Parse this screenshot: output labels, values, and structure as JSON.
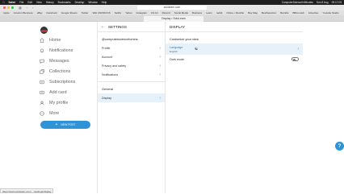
{
  "menubar": {
    "items": [
      "Safari",
      "File",
      "Edit",
      "View",
      "History",
      "Bookmarks",
      "Develop",
      "Window",
      "Help"
    ],
    "right": [
      "ComputerScienceInMinutes",
      "Sun 8 Aug",
      "09:17:03"
    ]
  },
  "browser": {
    "url": "sololearn.com",
    "tab_title": "Display • SoloLearn",
    "favorites": [
      "Apple",
      "Amazon Business",
      "eBay",
      "Facebook",
      "Google Sheets",
      "Twitter",
      "Wiki UNIXDOCS",
      "Netflix",
      "Yahoo",
      "Instagram",
      "CS Art",
      "Discord",
      "Social Media",
      "Business",
      "Learn",
      "reddit",
      "Online • Flexible",
      "Bay Mag",
      "BestSelection",
      "Bamble",
      "BBCo-Hub",
      "Advertise",
      "Youtube Studio"
    ],
    "status_url": "https://www.sololearn.com/..../settings/display"
  },
  "sidebar": {
    "items": [
      {
        "label": "Home",
        "icon": "home-icon"
      },
      {
        "label": "Notifications",
        "icon": "bell-icon"
      },
      {
        "label": "Messages",
        "icon": "message-icon"
      },
      {
        "label": "Collections",
        "icon": "collections-icon"
      },
      {
        "label": "Subscriptions",
        "icon": "subscriptions-icon"
      },
      {
        "label": "Add card",
        "icon": "add-card-icon"
      },
      {
        "label": "My profile",
        "icon": "profile-icon"
      },
      {
        "label": "More",
        "icon": "more-icon"
      }
    ],
    "new_post": "NEW POST"
  },
  "settings": {
    "title": "SETTINGS",
    "username": "@computerscienceinmins",
    "account_rows": [
      "Profile",
      "Account",
      "Privacy and safety",
      "Notifications"
    ],
    "general_label": "General",
    "general_rows": [
      "Display"
    ]
  },
  "display": {
    "title": "DISPLAY",
    "section": "Customize your view",
    "language_label": "Language",
    "language_value": "English",
    "dark_mode_label": "Dark mode",
    "dark_mode_on": false
  },
  "colors": {
    "accent": "#2f93d8",
    "active_bg": "#e6f1fa"
  }
}
